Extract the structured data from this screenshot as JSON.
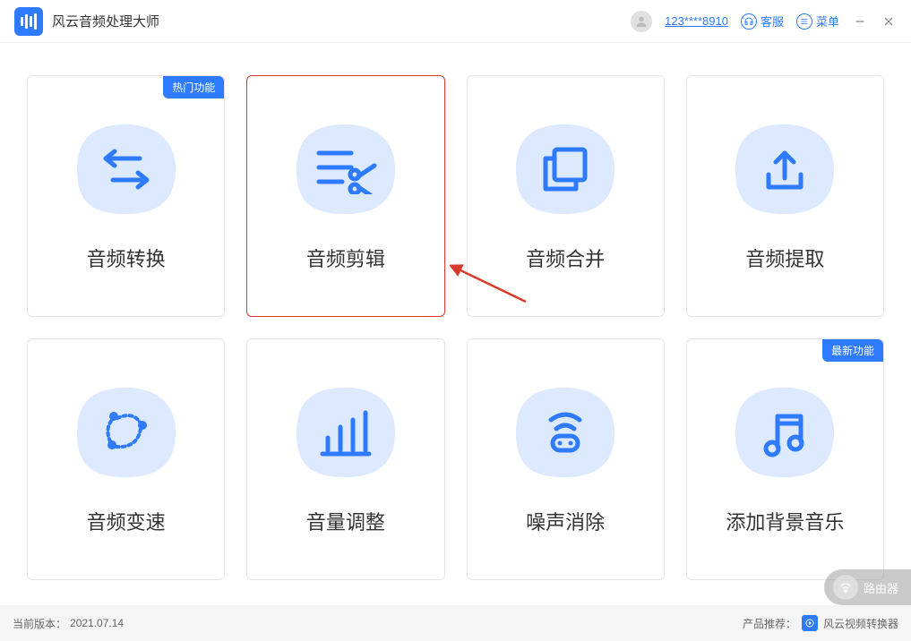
{
  "app": {
    "title": "风云音频处理大师"
  },
  "header": {
    "username": "123****8910",
    "support": "客服",
    "menu": "菜单"
  },
  "badges": {
    "hot": "热门功能",
    "new": "最新功能"
  },
  "cards": [
    {
      "label": "音频转换",
      "icon": "convert"
    },
    {
      "label": "音频剪辑",
      "icon": "cut"
    },
    {
      "label": "音频合并",
      "icon": "merge"
    },
    {
      "label": "音频提取",
      "icon": "extract"
    },
    {
      "label": "音频变速",
      "icon": "speed"
    },
    {
      "label": "音量调整",
      "icon": "volume"
    },
    {
      "label": "噪声消除",
      "icon": "denoise"
    },
    {
      "label": "添加背景音乐",
      "icon": "bgm"
    }
  ],
  "footer": {
    "version_label": "当前版本：",
    "version": "2021.07.14",
    "recommend_label": "产品推荐：",
    "recommend_app": "风云视频转换器"
  },
  "watermark": "路由器",
  "colors": {
    "primary": "#2f7bff",
    "blob": "#dce9ff",
    "highlight": "#d93a2b"
  }
}
